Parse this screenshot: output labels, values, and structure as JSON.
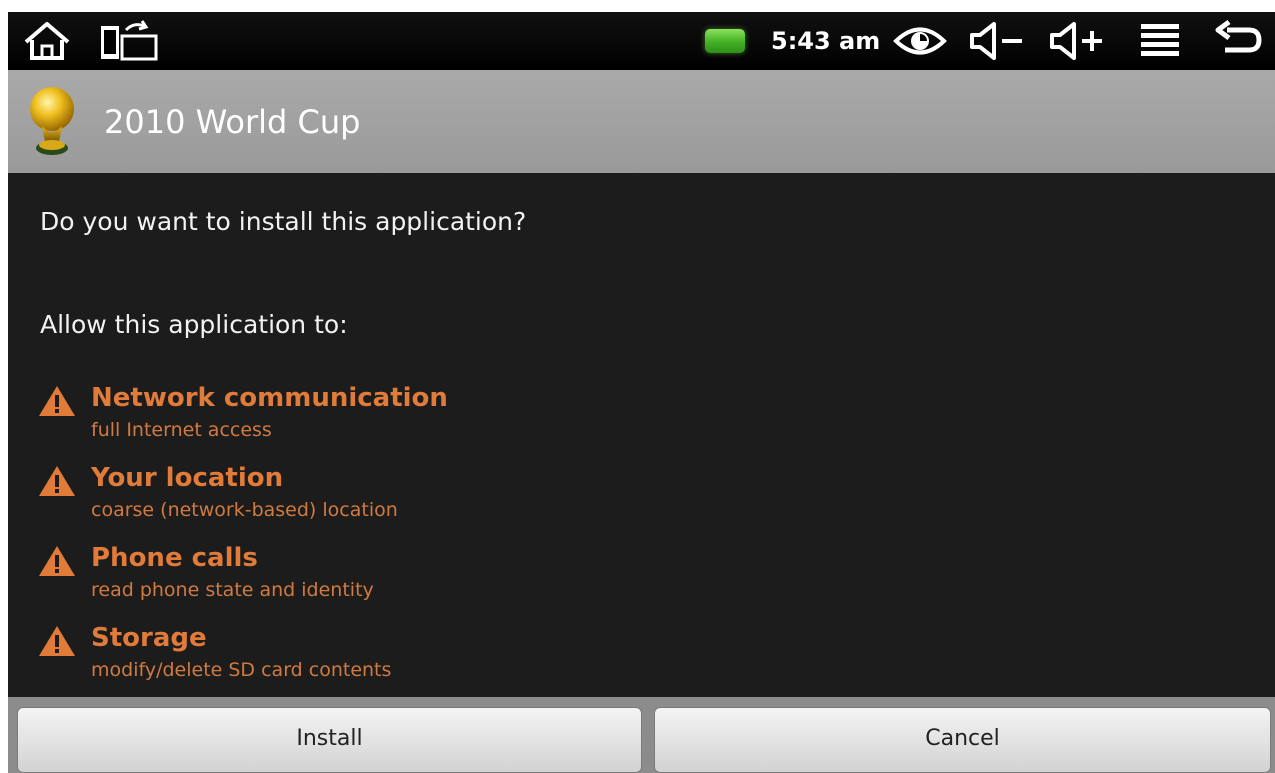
{
  "status_bar": {
    "icons_left": [
      "home-icon",
      "switch-orientation-icon"
    ],
    "battery_color": "#43b025",
    "time": "5:43 am",
    "icons_right": [
      "eye-icon",
      "volume-down-icon",
      "volume-up-icon",
      "menu-icon",
      "back-icon"
    ]
  },
  "title_bar": {
    "app_icon": "trophy-icon",
    "app_name": "2010 World Cup"
  },
  "content": {
    "question": "Do you want to install this application?",
    "allow_heading": "Allow this application to:",
    "permissions": [
      {
        "title": "Network communication",
        "description": "full Internet access"
      },
      {
        "title": "Your location",
        "description": "coarse (network-based) location"
      },
      {
        "title": "Phone calls",
        "description": "read phone state and identity"
      },
      {
        "title": "Storage",
        "description": "modify/delete SD card contents"
      }
    ],
    "warning_color": "#e07b3a"
  },
  "buttons": {
    "install_label": "Install",
    "cancel_label": "Cancel"
  }
}
